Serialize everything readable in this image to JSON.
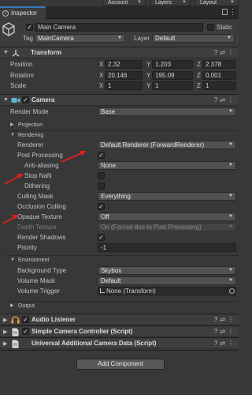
{
  "window": {
    "tab_account": "Account",
    "tab_layers": "Layers",
    "tab_layout": "Layout",
    "inspector_tab": "Inspector"
  },
  "object": {
    "name": "Main Camera",
    "static_label": "Static",
    "tag_label": "Tag",
    "tag_value": "MainCamera",
    "layer_label": "Layer",
    "layer_value": "Default"
  },
  "transform": {
    "title": "Transform",
    "rows": [
      {
        "label": "Position",
        "x": "2.32",
        "y": "1.203",
        "z": "2.378"
      },
      {
        "label": "Rotation",
        "x": "20.146",
        "y": "195.09",
        "z": "0.001"
      },
      {
        "label": "Scale",
        "x": "1",
        "y": "1",
        "z": "1"
      }
    ]
  },
  "camera": {
    "title": "Camera",
    "render_mode_label": "Render Mode",
    "render_mode": "Base",
    "projection": "Projection",
    "rendering": "Rendering",
    "renderer_label": "Renderer",
    "renderer_value": "Default Renderer (ForwardRenderer)",
    "post_processing": "Post Processing",
    "anti_aliasing_label": "Anti-aliasing",
    "anti_aliasing_value": "None",
    "stop_nan": "Stop NaN",
    "dithering": "Dithering",
    "culling_mask_label": "Culling Mask",
    "culling_mask_value": "Everything",
    "occlusion_culling": "Occlusion Culling",
    "opaque_texture_label": "Opaque Texture",
    "opaque_texture_value": "Off",
    "depth_texture_label": "Depth Texture",
    "depth_texture_value": "On (Forced due to Post Processing)",
    "render_shadows": "Render Shadows",
    "priority_label": "Priority",
    "priority_value": "-1",
    "environment": "Environment",
    "bg_type_label": "Background Type",
    "bg_type_value": "Skybox",
    "volume_mask_label": "Volume Mask",
    "volume_mask_value": "Default",
    "volume_trigger_label": "Volume Trigger",
    "volume_trigger_value": "None (Transform)",
    "output": "Output"
  },
  "components": {
    "audio_listener": "Audio Listener",
    "simple_controller": "Simple Camera Controller (Script)",
    "universal_data": "Universal Additional Camera Data (Script)"
  },
  "add_component": "Add Component",
  "glyphs": {
    "check": "✓",
    "help": "?",
    "settings": "⇄",
    "menu": "⋮",
    "tri_down": "▼",
    "tri_right": "▶",
    "dd_arrow": "▼",
    "x": "X",
    "y": "Y",
    "z": "Z"
  },
  "colors": {
    "accent": "#3a79bb",
    "annotation": "#e0201a"
  }
}
